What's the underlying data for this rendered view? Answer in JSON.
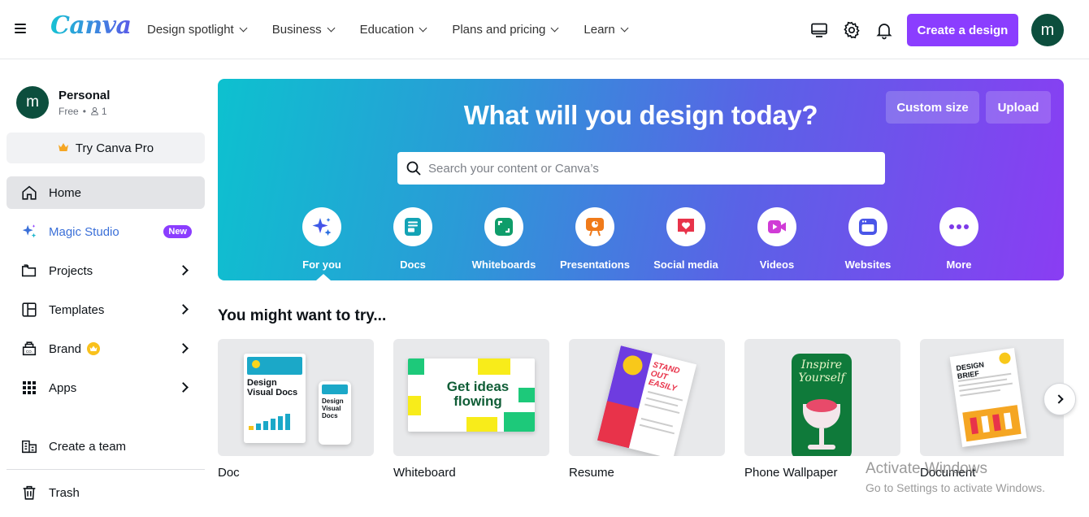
{
  "brand": {
    "logo": "Canva",
    "accent": "#8b3dff",
    "avatar_color": "#0c4e3d"
  },
  "header": {
    "nav": [
      {
        "label": "Design spotlight"
      },
      {
        "label": "Business"
      },
      {
        "label": "Education"
      },
      {
        "label": "Plans and pricing"
      },
      {
        "label": "Learn"
      }
    ],
    "icons": [
      "monitor-icon",
      "gear-icon",
      "bell-icon"
    ],
    "create_label": "Create a design",
    "avatar_initial": "m"
  },
  "sidebar": {
    "profile": {
      "initial": "m",
      "name": "Personal",
      "plan": "Free",
      "members": "1"
    },
    "try_pro_label": "Try Canva Pro",
    "items": [
      {
        "label": "Home",
        "icon": "home-icon"
      },
      {
        "label": "Magic Studio",
        "icon": "sparkle-icon",
        "badge": "New"
      },
      {
        "label": "Projects",
        "icon": "folder-icon"
      },
      {
        "label": "Templates",
        "icon": "templates-icon"
      },
      {
        "label": "Brand",
        "icon": "brand-icon"
      },
      {
        "label": "Apps",
        "icon": "apps-grid-icon"
      }
    ],
    "create_team_label": "Create a team",
    "trash_label": "Trash"
  },
  "hero": {
    "title": "What will you design today?",
    "custom_size_label": "Custom size",
    "upload_label": "Upload",
    "search_placeholder": "Search your content or Canva’s",
    "categories": [
      {
        "label": "For you",
        "icon": "sparkle-icon"
      },
      {
        "label": "Docs",
        "icon": "doc-icon"
      },
      {
        "label": "Whiteboards",
        "icon": "whiteboard-icon"
      },
      {
        "label": "Presentations",
        "icon": "presentation-icon"
      },
      {
        "label": "Social media",
        "icon": "heart-icon"
      },
      {
        "label": "Videos",
        "icon": "video-icon"
      },
      {
        "label": "Websites",
        "icon": "website-icon"
      },
      {
        "label": "More",
        "icon": "more-dots-icon"
      }
    ]
  },
  "try_section": {
    "title": "You might want to try...",
    "cards": [
      {
        "label": "Doc",
        "thumb_text": "Design Visual Docs"
      },
      {
        "label": "Whiteboard",
        "thumb_text": "Get ideas flowing"
      },
      {
        "label": "Resume",
        "thumb_text": "STAND OUT EASILY"
      },
      {
        "label": "Phone Wallpaper",
        "thumb_text": "Inspire Yourself"
      },
      {
        "label": "Document",
        "thumb_text": "DESIGN BRIEF"
      }
    ]
  },
  "watermark": {
    "title": "Activate Windows",
    "subtitle": "Go to Settings to activate Windows."
  }
}
